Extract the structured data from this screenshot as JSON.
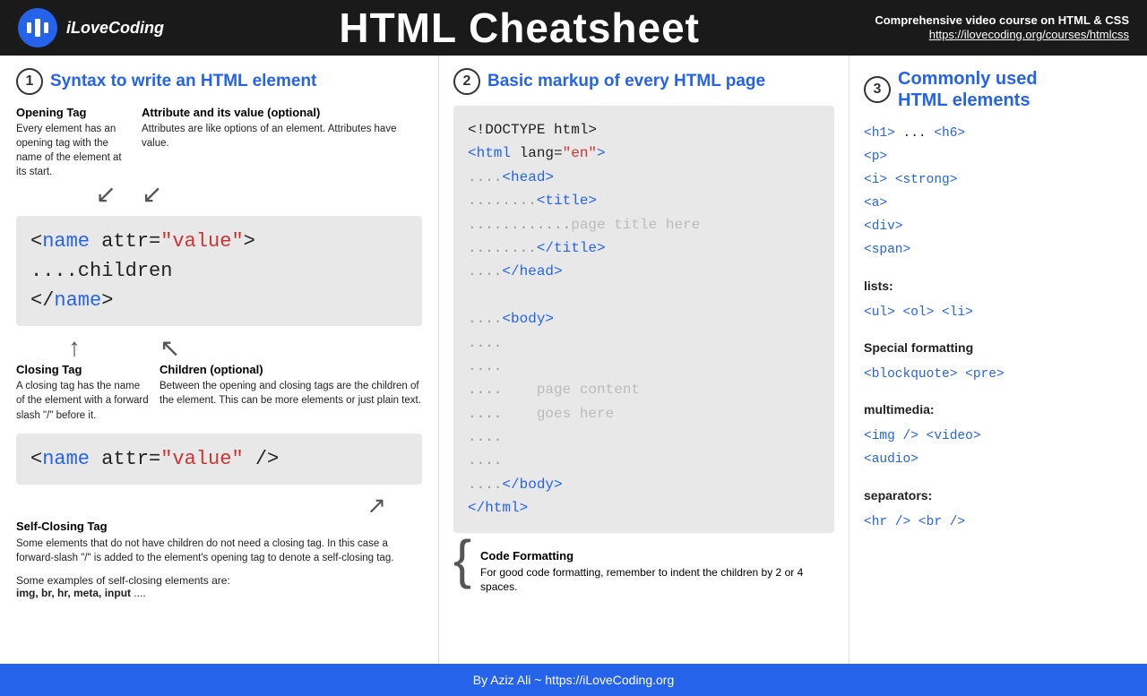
{
  "header": {
    "logo_text": "iLoveCoding",
    "title": "HTML Cheatsheet",
    "course_label": "Comprehensive video course on HTML & CSS",
    "course_url": "https://ilovecoding.org/courses/htmlcss"
  },
  "section1": {
    "number": "1",
    "title": "Syntax to write an HTML element",
    "opening_tag_title": "Opening Tag",
    "opening_tag_desc": "Every element has an opening tag with the name of the element at its start.",
    "attribute_title": "Attribute and its value (optional)",
    "attribute_desc": "Attributes are like options of an element. Attributes have value.",
    "code_line1_pre": "<",
    "code_line1_name": "name",
    "code_line1_attr": " attr=",
    "code_line1_val": "\"value\"",
    "code_line1_post": ">",
    "code_line2": "....children",
    "code_line3_pre": "</",
    "code_line3_name": "name",
    "code_line3_post": ">",
    "closing_tag_title": "Closing Tag",
    "closing_tag_desc": "A closing tag has the name of the element with a forward slash \"/\" before it.",
    "children_title": "Children (optional)",
    "children_desc": "Between the opening and closing tags are the children of the element. This can be more elements or just plain text.",
    "self_code_line1_pre": "<",
    "self_code_line1_name": "name",
    "self_code_line1_attr": " attr=",
    "self_code_line1_val": "\"value\"",
    "self_code_line1_post": " />",
    "self_closing_title": "Self-Closing Tag",
    "self_closing_desc": "Some elements that do not have children do not need a closing tag. In this case a forward-slash \"/\" is added to the element's opening tag to denote a self-closing tag.",
    "examples_label": "Some examples of self-closing elements are:",
    "examples_bold": "img, br, hr, meta, input",
    "examples_suffix": " ...."
  },
  "section2": {
    "number": "2",
    "title": "Basic markup of every HTML page",
    "code": [
      {
        "type": "black",
        "text": "<!DOCTYPE html>"
      },
      {
        "type": "tag_open",
        "pre": "<",
        "tag": "html",
        "attr": " lang=",
        "val": "\"en\"",
        "post": ">"
      },
      {
        "type": "indent",
        "dots": "....",
        "pre": "<",
        "tag": "head",
        "post": ">"
      },
      {
        "type": "indent2",
        "dots": "........",
        "pre": "<",
        "tag": "title",
        "post": ">"
      },
      {
        "type": "indent3",
        "dots": "............",
        "text": "page title here"
      },
      {
        "type": "indent2",
        "dots": "........",
        "pre": "</",
        "tag": "title",
        "post": ">"
      },
      {
        "type": "indent",
        "dots": "....",
        "pre": "</",
        "tag": "head",
        "post": ">"
      },
      {
        "type": "blank"
      },
      {
        "type": "indent",
        "dots": "....",
        "pre": "<",
        "tag": "body",
        "post": ">"
      },
      {
        "type": "blank_dots",
        "dots": "...."
      },
      {
        "type": "blank_dots",
        "dots": "...."
      },
      {
        "type": "indent_comment",
        "dots": "....    ",
        "text": "page content"
      },
      {
        "type": "indent_comment",
        "dots": "....    ",
        "text": "goes here"
      },
      {
        "type": "blank_dots",
        "dots": "...."
      },
      {
        "type": "blank_dots",
        "dots": "...."
      },
      {
        "type": "indent",
        "dots": "....",
        "pre": "</",
        "tag": "body",
        "post": ">"
      },
      {
        "type": "tag_close",
        "pre": "</",
        "tag": "html",
        "post": ">"
      }
    ],
    "formatting_title": "Code Formatting",
    "formatting_desc": "For good code formatting, remember to indent the children by 2 or 4 spaces."
  },
  "section3": {
    "number": "3",
    "title": "Commonly used\nHTML elements",
    "elements": [
      {
        "type": "code",
        "text": "<h1> ... <h6>"
      },
      {
        "type": "code",
        "text": "<p>"
      },
      {
        "type": "code",
        "text": "<i> <strong>"
      },
      {
        "type": "code",
        "text": "<a>"
      },
      {
        "type": "code",
        "text": "<div>"
      },
      {
        "type": "code",
        "text": "<span>"
      },
      {
        "type": "category",
        "text": "lists:"
      },
      {
        "type": "code",
        "text": "<ul>  <ol>  <li>"
      },
      {
        "type": "category",
        "text": "Special formatting"
      },
      {
        "type": "code",
        "text": "<blockquote>  <pre>"
      },
      {
        "type": "category",
        "text": "multimedia:"
      },
      {
        "type": "code",
        "text": "<img />  <video>"
      },
      {
        "type": "code",
        "text": "<audio>"
      },
      {
        "type": "category",
        "text": "separators:"
      },
      {
        "type": "code",
        "text": "<hr />  <br />"
      }
    ]
  },
  "footer": {
    "text": "By Aziz Ali ~ https://iLoveCoding.org"
  }
}
